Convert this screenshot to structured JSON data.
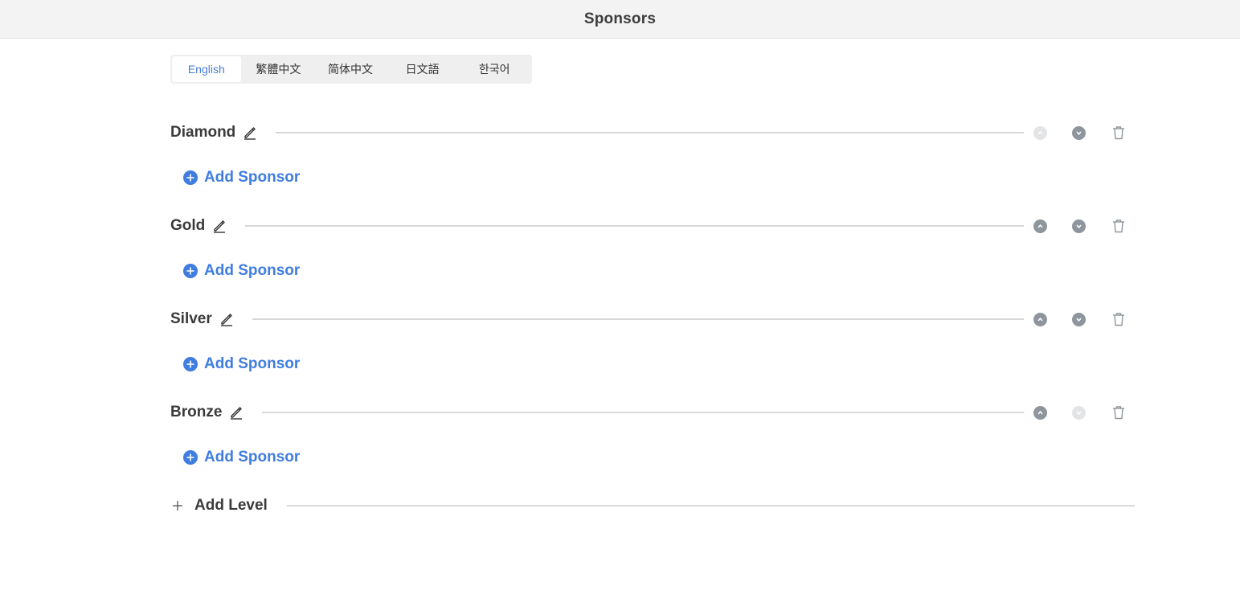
{
  "header": {
    "title": "Sponsors"
  },
  "language_tabs": [
    {
      "label": "English",
      "active": true
    },
    {
      "label": "繁體中文",
      "active": false
    },
    {
      "label": "简体中文",
      "active": false
    },
    {
      "label": "日文語",
      "active": false
    },
    {
      "label": "한국어",
      "active": false
    }
  ],
  "levels": [
    {
      "name": "Diamond",
      "move_up_enabled": false,
      "move_down_enabled": true,
      "add_sponsor_label": "Add Sponsor"
    },
    {
      "name": "Gold",
      "move_up_enabled": true,
      "move_down_enabled": true,
      "add_sponsor_label": "Add Sponsor"
    },
    {
      "name": "Silver",
      "move_up_enabled": true,
      "move_down_enabled": true,
      "add_sponsor_label": "Add Sponsor"
    },
    {
      "name": "Bronze",
      "move_up_enabled": true,
      "move_down_enabled": false,
      "add_sponsor_label": "Add Sponsor"
    }
  ],
  "add_level_label": "Add Level",
  "colors": {
    "accent": "#3f7de0",
    "active_tab_text": "#4a7fd8",
    "control_gray": "#8e959c",
    "control_disabled": "#e2e4e6"
  },
  "icons": {
    "edit": "pencil-icon",
    "up": "chevron-up-circle-icon",
    "down": "chevron-down-circle-icon",
    "delete": "trash-icon",
    "add_sponsor": "plus-circle-icon",
    "add_level": "plus-icon"
  }
}
